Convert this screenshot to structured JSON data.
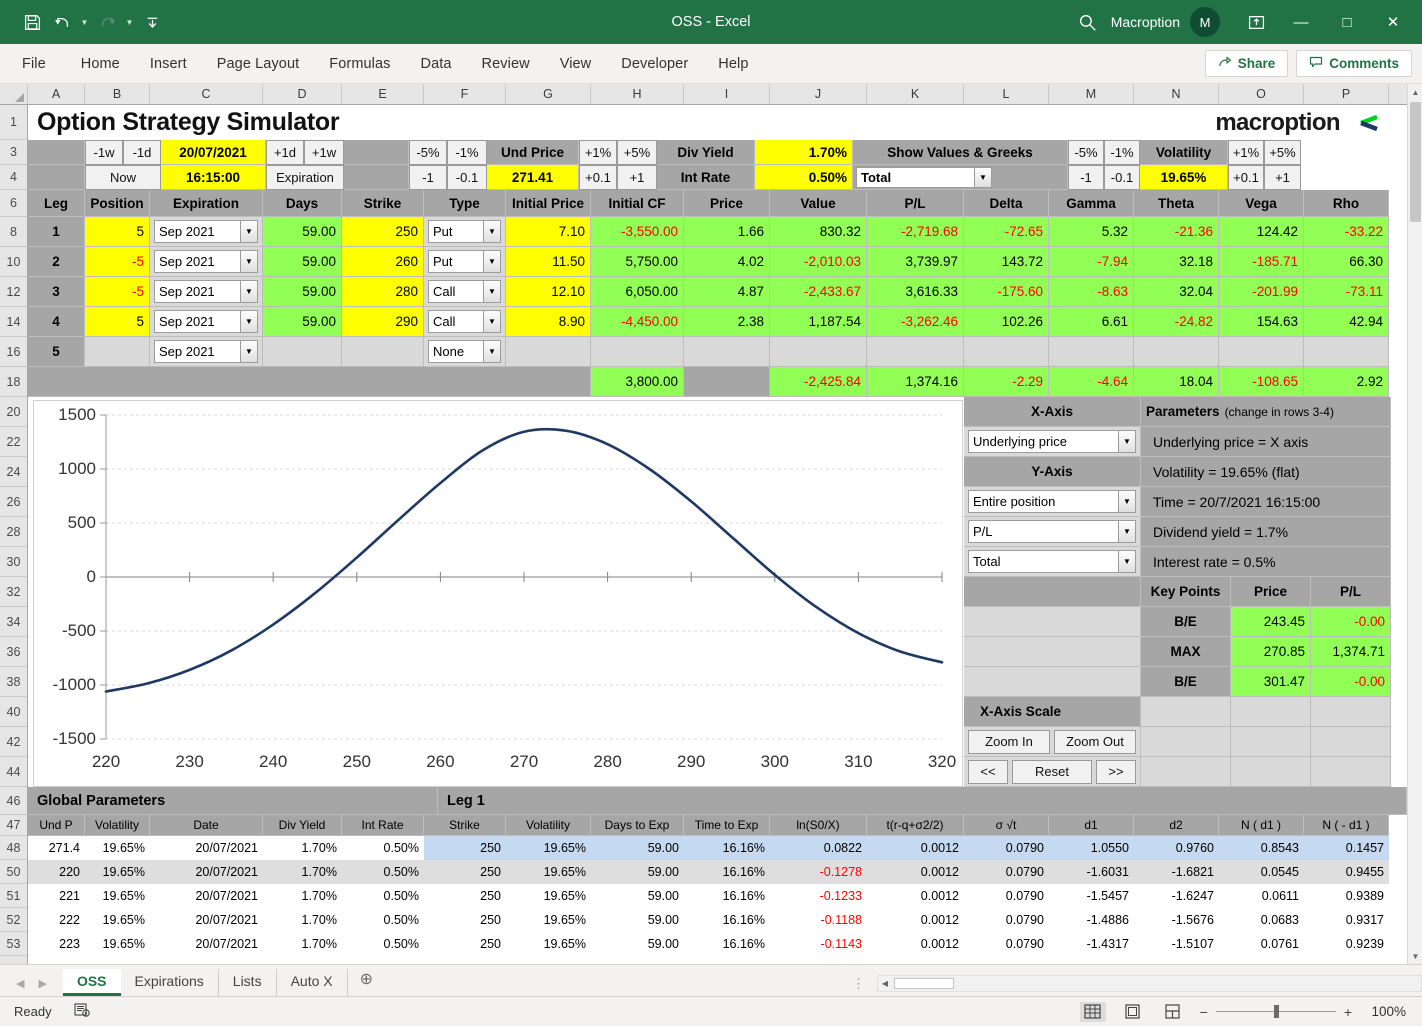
{
  "titlebar": {
    "doc_title": "OSS  -  Excel",
    "account": "Macroption",
    "avatar_initial": "M",
    "qat": [
      {
        "name": "save-icon",
        "glyph": "὚B"
      },
      {
        "name": "undo-icon",
        "glyph": "↶"
      },
      {
        "name": "redo-icon",
        "glyph": "↷"
      },
      {
        "name": "customize-qat-icon",
        "glyph": "⯆"
      }
    ],
    "search_icon": "⌕",
    "ribbon_display_icon": "↗",
    "minimize": "—",
    "maximize": "□",
    "close": "✕"
  },
  "ribbon": {
    "tabs": [
      "File",
      "Home",
      "Insert",
      "Page Layout",
      "Formulas",
      "Data",
      "Review",
      "View",
      "Developer",
      "Help"
    ],
    "share_label": "Share",
    "comments_label": "Comments"
  },
  "grid": {
    "columns": [
      "A",
      "B",
      "C",
      "D",
      "E",
      "F",
      "G",
      "H",
      "I",
      "J",
      "K",
      "L",
      "M",
      "N",
      "O",
      "P"
    ],
    "rows": [
      "1",
      "3",
      "4",
      "6",
      "8",
      "10",
      "12",
      "14",
      "16",
      "18",
      "20",
      "22",
      "24",
      "26",
      "28",
      "30",
      "32",
      "34",
      "36",
      "38",
      "40",
      "42",
      "44",
      "46",
      "47",
      "48",
      "50",
      "51",
      "52",
      "53"
    ]
  },
  "header": {
    "title": "Option Strategy Simulator",
    "logo_text": "macroption"
  },
  "controls": {
    "date_minus_week": "-1w",
    "date_minus_day": "-1d",
    "date_value": "20/07/2021",
    "date_plus_day": "+1d",
    "date_plus_week": "+1w",
    "now_label": "Now",
    "time_value": "16:15:00",
    "expiration_label": "Expiration",
    "price_minus5pct": "-5%",
    "price_minus1pct": "-1%",
    "und_price_label": "Und Price",
    "price_plus1pct": "+1%",
    "price_plus5pct": "+5%",
    "price_minus1": "-1",
    "price_minus01": "-0.1",
    "und_price_value": "271.41",
    "price_plus01": "+0.1",
    "price_plus1": "+1",
    "div_yield_label": "Div Yield",
    "div_yield_value": "1.70%",
    "int_rate_label": "Int Rate",
    "int_rate_value": "0.50%",
    "show_values_label": "Show Values & Greeks",
    "show_values_selected": "Total",
    "vol_minus5pct": "-5%",
    "vol_minus1pct": "-1%",
    "volatility_label": "Volatility",
    "vol_plus1pct": "+1%",
    "vol_plus5pct": "+5%",
    "vol_minus1": "-1",
    "vol_minus01": "-0.1",
    "volatility_value": "19.65%",
    "vol_plus01": "+0.1",
    "vol_plus1": "+1"
  },
  "legs_table": {
    "headers": [
      "Leg",
      "Position",
      "Expiration",
      "Days",
      "Strike",
      "Type",
      "Initial Price",
      "Initial CF",
      "Price",
      "Value",
      "P/L",
      "Delta",
      "Gamma",
      "Theta",
      "Vega",
      "Rho"
    ],
    "rows": [
      {
        "leg": "1",
        "position": "5",
        "expiration": "Sep 2021",
        "days": "59.00",
        "strike": "250",
        "type": "Put",
        "initial_price": "7.10",
        "initial_cf": "-3,550.00",
        "price": "1.66",
        "value": "830.32",
        "pl": "-2,719.68",
        "delta": "-72.65",
        "gamma": "5.32",
        "theta": "-21.36",
        "vega": "124.42",
        "rho": "-33.22"
      },
      {
        "leg": "2",
        "position": "-5",
        "expiration": "Sep 2021",
        "days": "59.00",
        "strike": "260",
        "type": "Put",
        "initial_price": "11.50",
        "initial_cf": "5,750.00",
        "price": "4.02",
        "value": "-2,010.03",
        "pl": "3,739.97",
        "delta": "143.72",
        "gamma": "-7.94",
        "theta": "32.18",
        "vega": "-185.71",
        "rho": "66.30"
      },
      {
        "leg": "3",
        "position": "-5",
        "expiration": "Sep 2021",
        "days": "59.00",
        "strike": "280",
        "type": "Call",
        "initial_price": "12.10",
        "initial_cf": "6,050.00",
        "price": "4.87",
        "value": "-2,433.67",
        "pl": "3,616.33",
        "delta": "-175.60",
        "gamma": "-8.63",
        "theta": "32.04",
        "vega": "-201.99",
        "rho": "-73.11"
      },
      {
        "leg": "4",
        "position": "5",
        "expiration": "Sep 2021",
        "days": "59.00",
        "strike": "290",
        "type": "Call",
        "initial_price": "8.90",
        "initial_cf": "-4,450.00",
        "price": "2.38",
        "value": "1,187.54",
        "pl": "-3,262.46",
        "delta": "102.26",
        "gamma": "6.61",
        "theta": "-24.82",
        "vega": "154.63",
        "rho": "42.94"
      },
      {
        "leg": "5",
        "position": "",
        "expiration": "Sep 2021",
        "days": "",
        "strike": "",
        "type": "None",
        "initial_price": "",
        "initial_cf": "",
        "price": "",
        "value": "",
        "pl": "",
        "delta": "",
        "gamma": "",
        "theta": "",
        "vega": "",
        "rho": ""
      }
    ],
    "totals": {
      "initial_cf": "3,800.00",
      "value": "-2,425.84",
      "pl": "1,374.16",
      "delta": "-2.29",
      "gamma": "-4.64",
      "theta": "18.04",
      "vega": "-108.65",
      "rho": "2.92"
    }
  },
  "sidepanel": {
    "x_axis_label": "X-Axis",
    "x_axis_select": "Underlying price",
    "y_axis_label": "Y-Axis",
    "y_axis_select_1": "Entire position",
    "y_axis_select_2": "P/L",
    "y_axis_select_3": "Total",
    "parameters_title": "Parameters",
    "parameters_note": "(change in rows 3-4)",
    "parameters": [
      "Underlying price = X axis",
      "Volatility = 19.65% (flat)",
      "Time = 20/7/2021 16:15:00",
      "Dividend yield = 1.7%",
      "Interest rate = 0.5%"
    ],
    "key_points_header": [
      "Key Points",
      "Price",
      "P/L"
    ],
    "key_points": [
      {
        "label": "B/E",
        "price": "243.45",
        "pl": "-0.00"
      },
      {
        "label": "MAX",
        "price": "270.85",
        "pl": "1,374.71"
      },
      {
        "label": "B/E",
        "price": "301.47",
        "pl": "-0.00"
      }
    ],
    "x_axis_scale_label": "X-Axis Scale",
    "zoom_in": "Zoom In",
    "zoom_out": "Zoom Out",
    "prev": "<<",
    "reset": "Reset",
    "next": ">>"
  },
  "chart_data": {
    "type": "line",
    "title": "",
    "xlabel": "",
    "ylabel": "",
    "xlim": [
      220,
      320
    ],
    "ylim": [
      -1500,
      1500
    ],
    "xticks": [
      220,
      230,
      240,
      250,
      260,
      270,
      280,
      290,
      300,
      310,
      320
    ],
    "yticks": [
      -1500,
      -1000,
      -500,
      0,
      500,
      1000,
      1500
    ],
    "grid": true,
    "legend": "none",
    "line_color": "#1F3864",
    "series": [
      {
        "name": "P/L Total",
        "x": [
          220,
          225,
          230,
          235,
          240,
          245,
          250,
          255,
          260,
          265,
          270,
          275,
          280,
          285,
          290,
          295,
          300,
          305,
          310,
          315,
          320
        ],
        "y": [
          -1060,
          -985,
          -860,
          -680,
          -440,
          -150,
          180,
          530,
          870,
          1170,
          1345,
          1355,
          1230,
          1000,
          700,
          360,
          20,
          -280,
          -520,
          -690,
          -790
        ]
      }
    ]
  },
  "bottom_table": {
    "group_global": "Global Parameters",
    "group_leg1": "Leg 1",
    "headers_global": [
      "Und P",
      "Volatility",
      "Date",
      "Div Yield",
      "Int Rate"
    ],
    "headers_leg": [
      "Strike",
      "Volatility",
      "Days to Exp",
      "Time to Exp",
      "ln(S0/X)",
      "t(r-q+σ2/2)",
      "σ √t",
      "d1",
      "d2",
      "N ( d1 )",
      "N ( - d1 )"
    ],
    "rows": [
      {
        "und_p": "271.4",
        "vol": "19.65%",
        "date": "20/07/2021",
        "div": "1.70%",
        "rate": "0.50%",
        "strike": "250",
        "leg_vol": "19.65%",
        "days": "59.00",
        "tte": "16.16%",
        "ln": "0.0822",
        "t_term": "0.0012",
        "sigt": "0.0790",
        "d1": "1.0550",
        "d2": "0.9760",
        "nd1": "0.8543",
        "nmd1": "0.1457",
        "highlight": true,
        "ln_neg": false
      },
      {
        "und_p": "220",
        "vol": "19.65%",
        "date": "20/07/2021",
        "div": "1.70%",
        "rate": "0.50%",
        "strike": "250",
        "leg_vol": "19.65%",
        "days": "59.00",
        "tte": "16.16%",
        "ln": "-0.1278",
        "t_term": "0.0012",
        "sigt": "0.0790",
        "d1": "-1.6031",
        "d2": "-1.6821",
        "nd1": "0.0545",
        "nmd1": "0.9455",
        "highlight": false,
        "ln_neg": true
      },
      {
        "und_p": "221",
        "vol": "19.65%",
        "date": "20/07/2021",
        "div": "1.70%",
        "rate": "0.50%",
        "strike": "250",
        "leg_vol": "19.65%",
        "days": "59.00",
        "tte": "16.16%",
        "ln": "-0.1233",
        "t_term": "0.0012",
        "sigt": "0.0790",
        "d1": "-1.5457",
        "d2": "-1.6247",
        "nd1": "0.0611",
        "nmd1": "0.9389",
        "highlight": false,
        "ln_neg": true
      },
      {
        "und_p": "222",
        "vol": "19.65%",
        "date": "20/07/2021",
        "div": "1.70%",
        "rate": "0.50%",
        "strike": "250",
        "leg_vol": "19.65%",
        "days": "59.00",
        "tte": "16.16%",
        "ln": "-0.1188",
        "t_term": "0.0012",
        "sigt": "0.0790",
        "d1": "-1.4886",
        "d2": "-1.5676",
        "nd1": "0.0683",
        "nmd1": "0.9317",
        "highlight": false,
        "ln_neg": true
      },
      {
        "und_p": "223",
        "vol": "19.65%",
        "date": "20/07/2021",
        "div": "1.70%",
        "rate": "0.50%",
        "strike": "250",
        "leg_vol": "19.65%",
        "days": "59.00",
        "tte": "16.16%",
        "ln": "-0.1143",
        "t_term": "0.0012",
        "sigt": "0.0790",
        "d1": "-1.4317",
        "d2": "-1.5107",
        "nd1": "0.0761",
        "nmd1": "0.9239",
        "highlight": false,
        "ln_neg": true
      }
    ]
  },
  "sheet_tabs": {
    "tabs": [
      "OSS",
      "Expirations",
      "Lists",
      "Auto X"
    ],
    "active": "OSS",
    "add_label": "⊕"
  },
  "statusbar": {
    "status": "Ready",
    "zoom": "100%",
    "zoom_minus": "−",
    "zoom_plus": "+"
  }
}
